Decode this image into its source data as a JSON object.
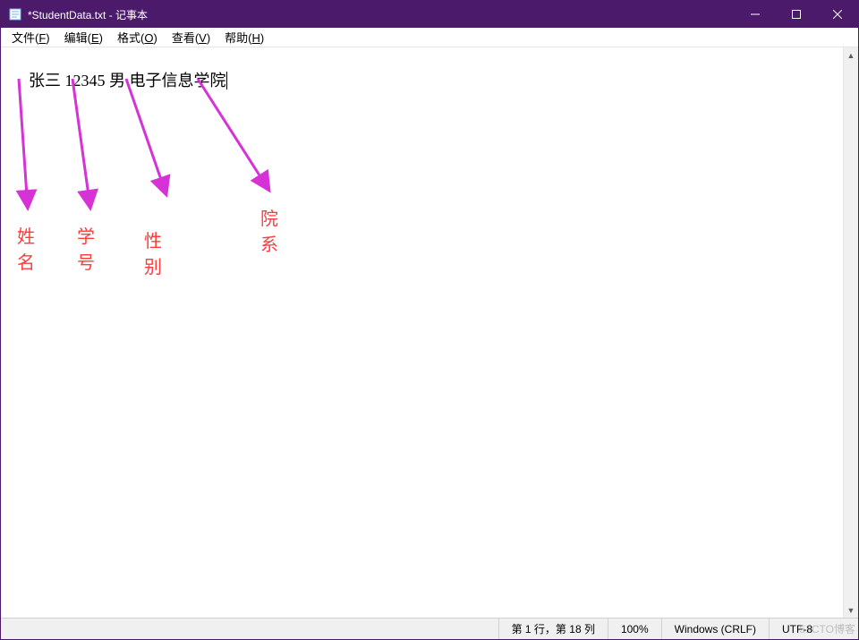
{
  "window": {
    "title": "*StudentData.txt - 记事本"
  },
  "menu": {
    "file": "文件(",
    "file_key": "F",
    "file_end": ")",
    "edit": "编辑(",
    "edit_key": "E",
    "edit_end": ")",
    "format": "格式(",
    "format_key": "O",
    "format_end": ")",
    "view": "查看(",
    "view_key": "V",
    "view_end": ")",
    "help": "帮助(",
    "help_key": "H",
    "help_end": ")"
  },
  "content": {
    "line1": "张三 12345 男 电子信息学院"
  },
  "status": {
    "position": "第 1 行，第 18 列",
    "zoom": "100%",
    "eol": "Windows (CRLF)",
    "encoding": "UTF-8"
  },
  "annotations": {
    "name": "姓名",
    "id": "学号",
    "gender": "性别",
    "dept": "院系"
  },
  "watermark": "51CTO博客"
}
